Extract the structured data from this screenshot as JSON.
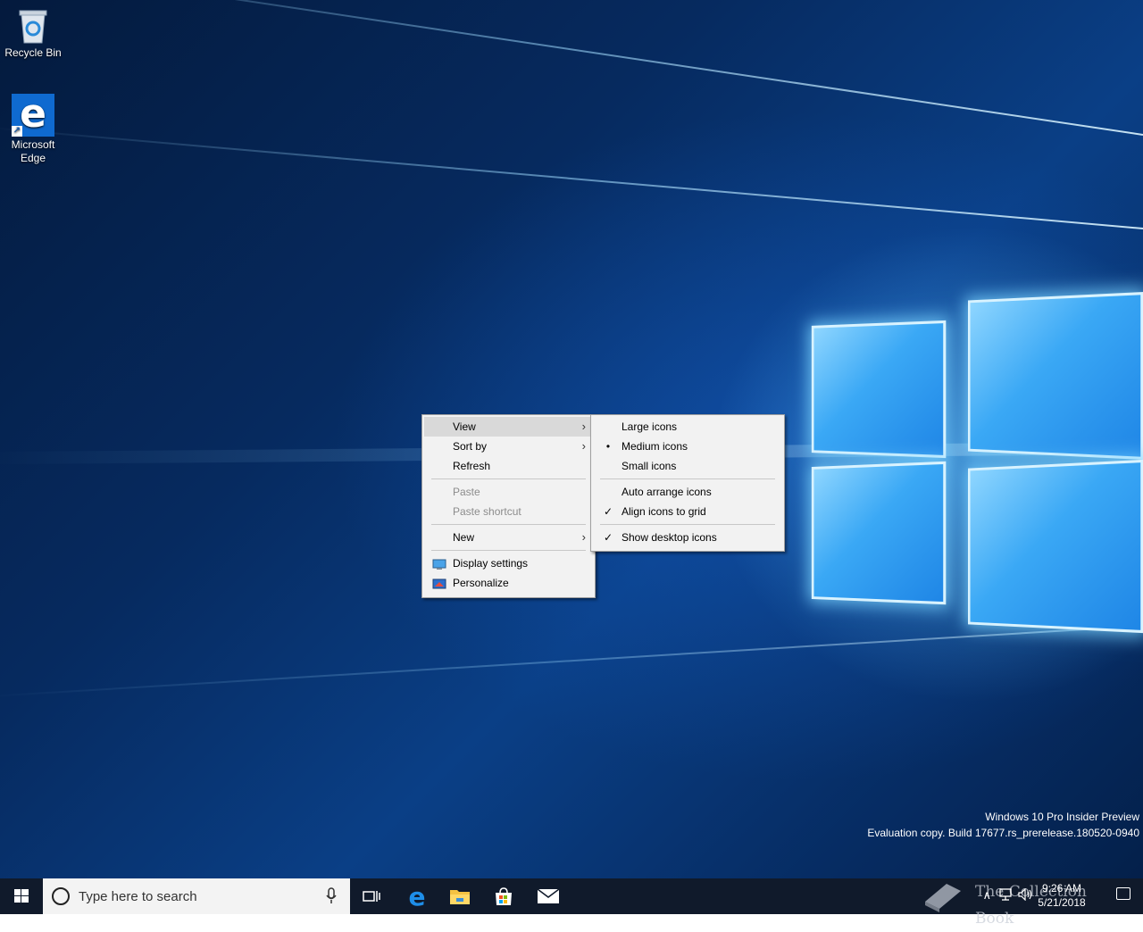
{
  "desktop": {
    "icons": [
      {
        "label": "Recycle Bin",
        "icon": "recycle-bin-icon"
      },
      {
        "label": "Microsoft\nEdge",
        "label_line1": "Microsoft",
        "label_line2": "Edge",
        "icon": "edge-icon"
      }
    ]
  },
  "context_menu": {
    "items": [
      {
        "label": "View",
        "has_submenu": true,
        "highlighted": true
      },
      {
        "label": "Sort by",
        "has_submenu": true
      },
      {
        "label": "Refresh"
      },
      {
        "label": "Paste",
        "disabled": true
      },
      {
        "label": "Paste shortcut",
        "disabled": true
      },
      {
        "label": "New",
        "has_submenu": true
      },
      {
        "label": "Display settings",
        "icon": "display-settings-icon"
      },
      {
        "label": "Personalize",
        "icon": "personalize-icon"
      }
    ]
  },
  "view_submenu": {
    "items": [
      {
        "label": "Large icons"
      },
      {
        "label": "Medium icons",
        "selected": true,
        "mark": "•"
      },
      {
        "label": "Small icons"
      },
      {
        "label": "Auto arrange icons"
      },
      {
        "label": "Align icons to grid",
        "checked": true,
        "mark": "✓"
      },
      {
        "label": "Show desktop icons",
        "checked": true,
        "mark": "✓"
      }
    ],
    "arrow": "›"
  },
  "watermark": {
    "line1": "Windows 10 Pro Insider Preview",
    "line2": "Evaluation copy. Build 17677.rs_prerelease.180520-0940"
  },
  "taskbar": {
    "search_placeholder": "Type here to search",
    "apps": [
      "task-view-icon",
      "edge-icon",
      "file-explorer-icon",
      "store-icon",
      "mail-icon"
    ],
    "clock_time": "9:26 AM",
    "clock_date": "5/21/2018",
    "overlay_text": "The Collection Book"
  },
  "colors": {
    "taskbar": "#101a2b",
    "menu_bg": "#f2f2f2",
    "menu_highlight": "#d9d9d9",
    "accent": "#0f6ad0"
  }
}
